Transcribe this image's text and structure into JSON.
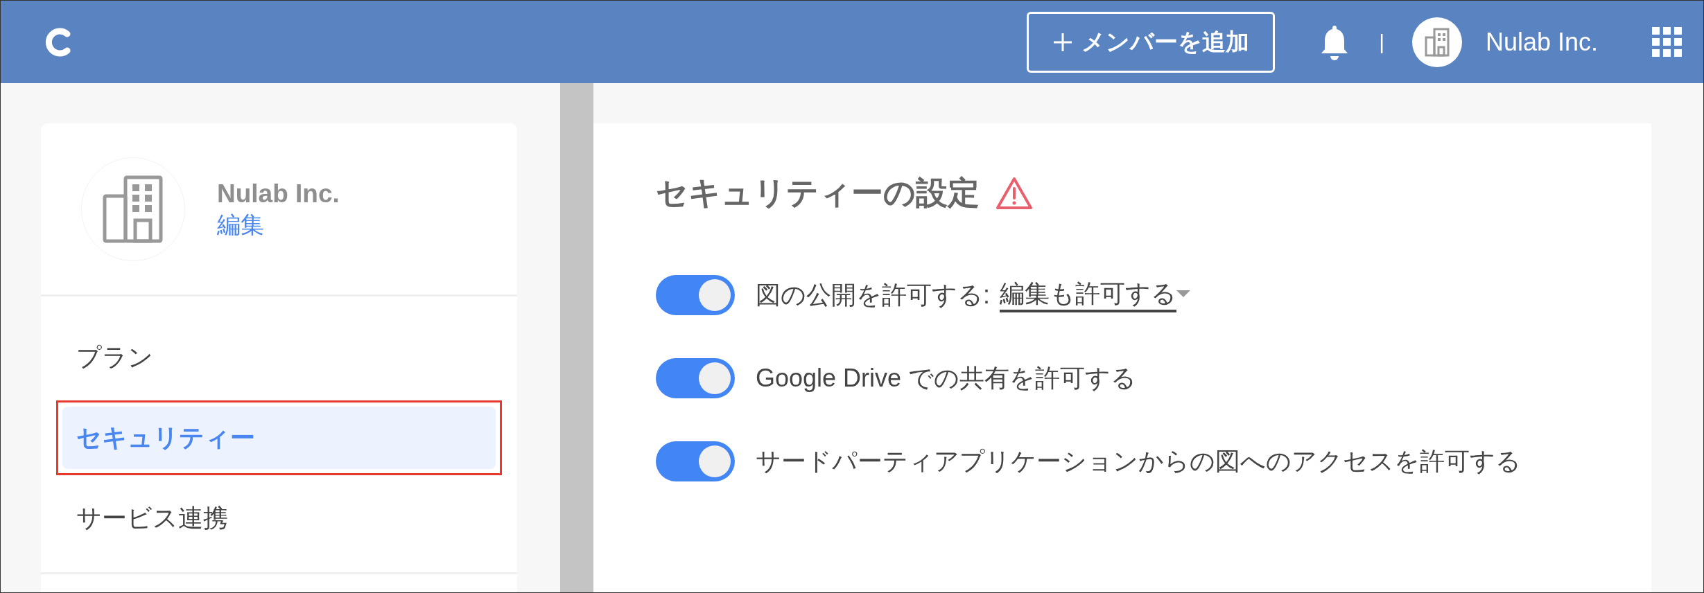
{
  "header": {
    "add_member_button": "メンバーを追加",
    "separator": "|",
    "org_name": "Nulab Inc."
  },
  "sidebar": {
    "org": {
      "name": "Nulab Inc.",
      "edit_link": "編集"
    },
    "items": [
      {
        "label": "プラン",
        "selected": false,
        "outlined": false
      },
      {
        "label": "セキュリティー",
        "selected": true,
        "outlined": true
      },
      {
        "label": "サービス連携",
        "selected": false,
        "outlined": false
      }
    ]
  },
  "main": {
    "title": "セキュリティーの設定",
    "settings": [
      {
        "kind": "dropdown",
        "on": true,
        "label": "図の公開を許可する:",
        "value": "編集も許可する"
      },
      {
        "kind": "plain",
        "on": true,
        "label": "Google Drive での共有を許可する"
      },
      {
        "kind": "plain",
        "on": true,
        "label": "サードパーティアプリケーションからの図へのアクセスを許可する"
      }
    ]
  }
}
